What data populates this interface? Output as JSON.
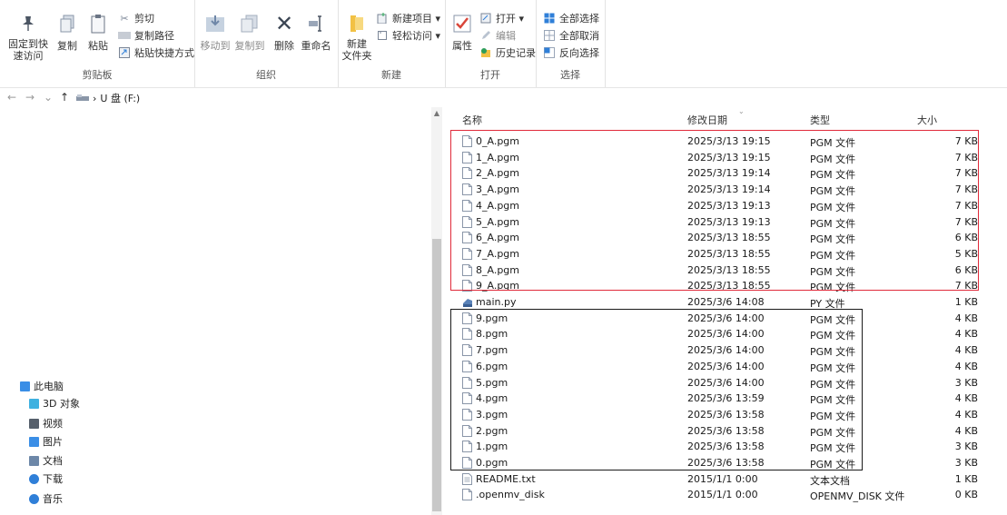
{
  "ribbon": {
    "clipboard": {
      "label": "剪贴板",
      "pin": "固定到快速访问",
      "copy": "复制",
      "paste": "粘贴",
      "cut": "剪切",
      "copy_path": "复制路径",
      "paste_shortcut": "粘贴快捷方式"
    },
    "organize": {
      "label": "组织",
      "move_to": "移动到",
      "copy_to": "复制到",
      "delete": "删除",
      "rename": "重命名"
    },
    "new": {
      "label": "新建",
      "new_folder": "新建\n文件夹",
      "new_item": "新建项目 ▾",
      "easy_access": "轻松访问 ▾"
    },
    "open": {
      "label": "打开",
      "properties": "属性",
      "open": "打开 ▾",
      "edit": "编辑",
      "history": "历史记录"
    },
    "select": {
      "label": "选择",
      "select_all": "全部选择",
      "select_none": "全部取消",
      "invert": "反向选择"
    }
  },
  "address": {
    "back": "←",
    "forward": "→",
    "recent": "⌄",
    "up": "↑",
    "separator": "›",
    "drive": "U 盘 (F:)"
  },
  "tree": [
    {
      "label": "此电脑",
      "icon": "pc-icon",
      "color": "#3a8ee6"
    },
    {
      "label": "3D 对象",
      "icon": "cube-icon",
      "color": "#3fb1e0"
    },
    {
      "label": "视频",
      "icon": "video-icon",
      "color": "#555f6b"
    },
    {
      "label": "图片",
      "icon": "picture-icon",
      "color": "#3a8ee6"
    },
    {
      "label": "文档",
      "icon": "document-icon",
      "color": "#6d87a8"
    },
    {
      "label": "下载",
      "icon": "download-icon",
      "color": "#2f7fd8"
    },
    {
      "label": "音乐",
      "icon": "music-icon",
      "color": "#2f7fd8"
    }
  ],
  "columns": {
    "name": "名称",
    "date": "修改日期",
    "type": "类型",
    "size": "大小"
  },
  "files": [
    {
      "name": "0_A.pgm",
      "date": "2025/3/13 19:15",
      "type": "PGM 文件",
      "size": "7 KB",
      "icon": "file-icon"
    },
    {
      "name": "1_A.pgm",
      "date": "2025/3/13 19:15",
      "type": "PGM 文件",
      "size": "7 KB",
      "icon": "file-icon"
    },
    {
      "name": "2_A.pgm",
      "date": "2025/3/13 19:14",
      "type": "PGM 文件",
      "size": "7 KB",
      "icon": "file-icon"
    },
    {
      "name": "3_A.pgm",
      "date": "2025/3/13 19:14",
      "type": "PGM 文件",
      "size": "7 KB",
      "icon": "file-icon"
    },
    {
      "name": "4_A.pgm",
      "date": "2025/3/13 19:13",
      "type": "PGM 文件",
      "size": "7 KB",
      "icon": "file-icon"
    },
    {
      "name": "5_A.pgm",
      "date": "2025/3/13 19:13",
      "type": "PGM 文件",
      "size": "7 KB",
      "icon": "file-icon"
    },
    {
      "name": "6_A.pgm",
      "date": "2025/3/13 18:55",
      "type": "PGM 文件",
      "size": "6 KB",
      "icon": "file-icon"
    },
    {
      "name": "7_A.pgm",
      "date": "2025/3/13 18:55",
      "type": "PGM 文件",
      "size": "5 KB",
      "icon": "file-icon"
    },
    {
      "name": "8_A.pgm",
      "date": "2025/3/13 18:55",
      "type": "PGM 文件",
      "size": "6 KB",
      "icon": "file-icon"
    },
    {
      "name": "9_A.pgm",
      "date": "2025/3/13 18:55",
      "type": "PGM 文件",
      "size": "7 KB",
      "icon": "file-icon"
    },
    {
      "name": "main.py",
      "date": "2025/3/6 14:08",
      "type": "PY 文件",
      "size": "1 KB",
      "icon": "python-file-icon"
    },
    {
      "name": "9.pgm",
      "date": "2025/3/6 14:00",
      "type": "PGM 文件",
      "size": "4 KB",
      "icon": "file-icon"
    },
    {
      "name": "8.pgm",
      "date": "2025/3/6 14:00",
      "type": "PGM 文件",
      "size": "4 KB",
      "icon": "file-icon"
    },
    {
      "name": "7.pgm",
      "date": "2025/3/6 14:00",
      "type": "PGM 文件",
      "size": "4 KB",
      "icon": "file-icon"
    },
    {
      "name": "6.pgm",
      "date": "2025/3/6 14:00",
      "type": "PGM 文件",
      "size": "4 KB",
      "icon": "file-icon"
    },
    {
      "name": "5.pgm",
      "date": "2025/3/6 14:00",
      "type": "PGM 文件",
      "size": "3 KB",
      "icon": "file-icon"
    },
    {
      "name": "4.pgm",
      "date": "2025/3/6 13:59",
      "type": "PGM 文件",
      "size": "4 KB",
      "icon": "file-icon"
    },
    {
      "name": "3.pgm",
      "date": "2025/3/6 13:58",
      "type": "PGM 文件",
      "size": "4 KB",
      "icon": "file-icon"
    },
    {
      "name": "2.pgm",
      "date": "2025/3/6 13:58",
      "type": "PGM 文件",
      "size": "4 KB",
      "icon": "file-icon"
    },
    {
      "name": "1.pgm",
      "date": "2025/3/6 13:58",
      "type": "PGM 文件",
      "size": "3 KB",
      "icon": "file-icon"
    },
    {
      "name": "0.pgm",
      "date": "2025/3/6 13:58",
      "type": "PGM 文件",
      "size": "3 KB",
      "icon": "file-icon"
    },
    {
      "name": "README.txt",
      "date": "2015/1/1 0:00",
      "type": "文本文档",
      "size": "1 KB",
      "icon": "text-file-icon"
    },
    {
      "name": ".openmv_disk",
      "date": "2015/1/1 0:00",
      "type": "OPENMV_DISK 文件",
      "size": "0 KB",
      "icon": "file-icon"
    }
  ],
  "annotations": {
    "red_box_color": "#e02a3a",
    "black_box_color": "#1a1a1a"
  }
}
